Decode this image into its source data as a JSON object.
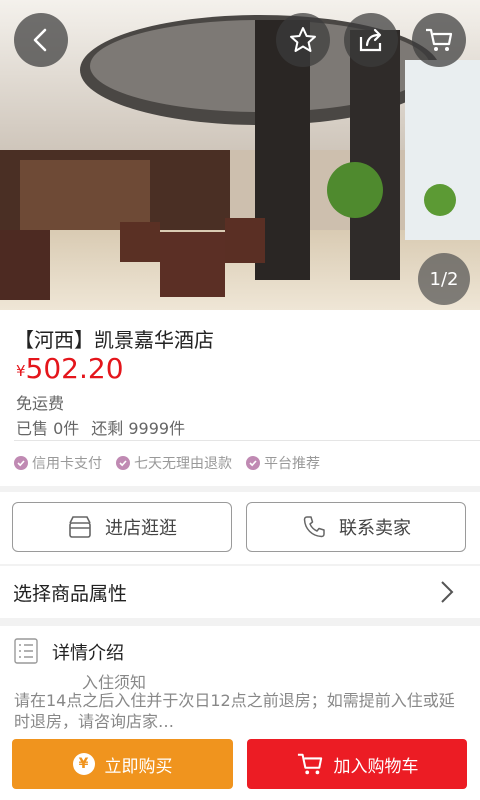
{
  "hero": {
    "pager": "1/2",
    "icons": [
      "back-icon",
      "star-icon",
      "share-icon",
      "cart-icon"
    ]
  },
  "product": {
    "title": "【河西】凯景嘉华酒店",
    "currency": "¥",
    "price": "502.20",
    "shipping": "免运费",
    "sold": "已售 0件",
    "remaining": "还剩 9999件",
    "price_color": "#e4151b"
  },
  "badges": [
    "信用卡支付",
    "七天无理由退款",
    "平台推荐"
  ],
  "actions": {
    "shop": "进店逛逛",
    "contact": "联系卖家"
  },
  "attributes": {
    "label": "选择商品属性"
  },
  "detail": {
    "title": "详情介绍",
    "subtitle": "入住须知",
    "body": "请在14点之后入住并于次日12点之前退房；如需提前入住或延时退房，请咨询店家…"
  },
  "bottom": {
    "buy": "立即购买",
    "add_cart": "加入购物车",
    "buy_color": "#f0941e",
    "cart_color": "#ec1c24"
  }
}
